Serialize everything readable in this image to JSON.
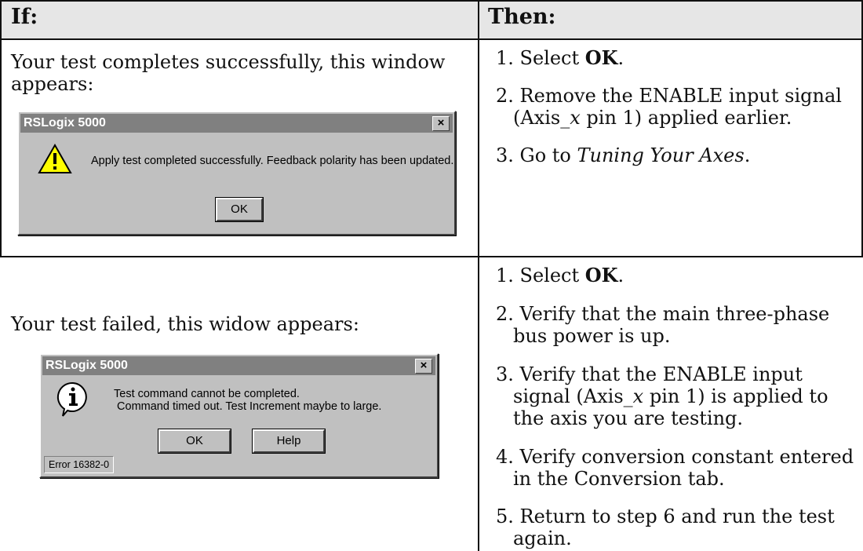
{
  "header": {
    "if_label": "If:",
    "then_label": "Then:"
  },
  "row1": {
    "condition_line1": "Your test completes successfully, this window",
    "condition_line2": "appears:",
    "dialog": {
      "title": "RSLogix 5000",
      "close": "×",
      "icon": "exclamation-icon",
      "message": "Apply test completed successfully. Feedback polarity has been updated.",
      "ok": "OK"
    },
    "steps": {
      "s1_pre": "1. Select ",
      "s1_bold": "OK",
      "s1_post": ".",
      "s2_line1": "2. Remove the ENABLE input signal",
      "s2_line2_a": "(Axis_",
      "s2_line2_x": "x",
      "s2_line2_b": " pin 1) applied earlier.",
      "s3_pre": "3. Go to ",
      "s3_italic": "Tuning Your Axes",
      "s3_post": "."
    }
  },
  "row2": {
    "condition": "Your test failed, this widow appears:",
    "dialog": {
      "title": "RSLogix 5000",
      "close": "×",
      "icon": "info-icon",
      "message_line1": "Test command cannot be completed.",
      "message_line2": " Command timed out. Test Increment maybe to large.",
      "ok": "OK",
      "help": "Help",
      "status": "Error 16382-0"
    },
    "steps": {
      "s1_pre": "1. Select ",
      "s1_bold": "OK",
      "s1_post": ".",
      "s2_line1": "2. Verify that the main three-phase",
      "s2_line2": "bus power is up.",
      "s3_line1": "3. Verify that the ENABLE input",
      "s3_line2_a": "signal (Axis_",
      "s3_line2_x": "x",
      "s3_line2_b": " pin 1) is applied to",
      "s3_line3": "the axis you are testing.",
      "s4_line1": "4. Verify conversion constant entered",
      "s4_line2": "in the Conversion tab.",
      "s5_line1": "5. Return to step 6 and run the test",
      "s5_line2": "again."
    }
  }
}
